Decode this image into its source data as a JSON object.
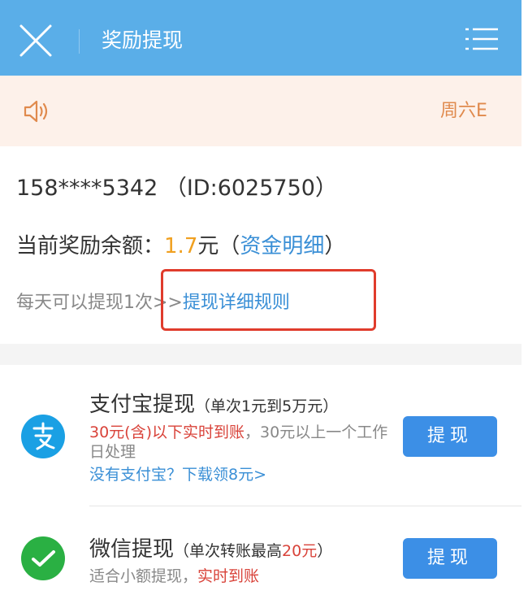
{
  "header": {
    "title": "奖励提现",
    "close_icon": "close-icon",
    "menu_icon": "menu-icon"
  },
  "notice": {
    "icon": "speaker-icon",
    "text": "周六E"
  },
  "account": {
    "phone": "158****5342",
    "id_text": "（ID:6025750）"
  },
  "balance": {
    "label": "当前奖励余额：",
    "amount": "1.7",
    "unit": "元",
    "paren_open": "（",
    "detail_link": "资金明细",
    "paren_close": "）"
  },
  "rule": {
    "prefix": "每天可以提现1次>>",
    "link": "提现详细规则"
  },
  "alipay": {
    "icon": "alipay-icon",
    "title": "支付宝提现",
    "subtitle": "（单次1元到5万元）",
    "desc_red": "30元(含)以下实时到账",
    "desc_rest": "，30元以上一个工作日处理",
    "download_link": "没有支付宝？下载领8元>",
    "button": "提现"
  },
  "wechat": {
    "icon": "wechat-icon",
    "title": "微信提现",
    "subtitle_a": "（单次转账最高",
    "subtitle_red": "20元",
    "subtitle_b": "）",
    "desc_a": "适合小额提现，",
    "desc_red": "实时到账",
    "button": "提现"
  },
  "colors": {
    "header_bg": "#5aaee8",
    "notice_bg": "#fdf1ea",
    "accent_blue": "#3a8fd6",
    "button_blue": "#3c8fe6",
    "amount_orange": "#f0a020",
    "red": "#d9433a",
    "highlight_red": "#e03c2c",
    "alipay_blue": "#1aa0e4",
    "wechat_green": "#2ab043"
  }
}
